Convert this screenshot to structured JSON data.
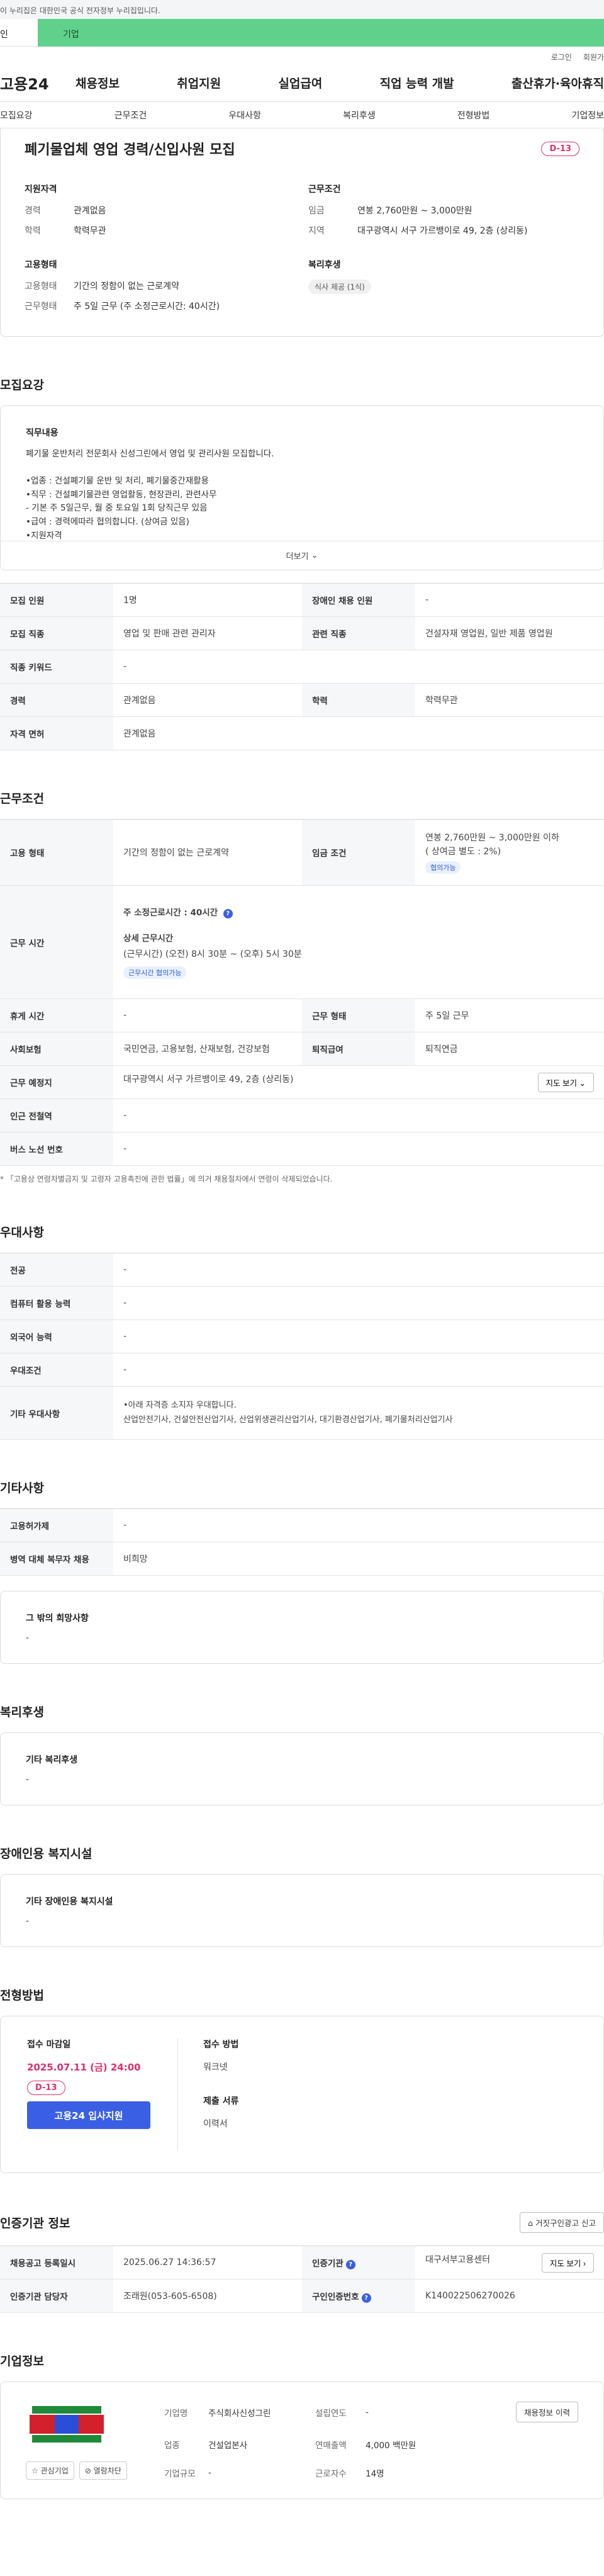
{
  "gov_bar": "이 누리집은 대한민국 공식 전자정부 누리집입니다.",
  "tabs": {
    "first": "인",
    "second": "기업"
  },
  "utility": {
    "login": "로그인",
    "join": "회원가"
  },
  "gnb": {
    "logo": "고용24",
    "menu": [
      "채용정보",
      "취업지원",
      "실업급여",
      "직업 능력 개발",
      "출산휴가·육아휴직"
    ]
  },
  "subnav": [
    "모집요강",
    "근무조건",
    "우대사항",
    "복리후생",
    "전형방법",
    "기업정보"
  ],
  "summary": {
    "title": "폐기물업체 영업 경력/신입사원 모집",
    "dday": "D-13",
    "qualification": {
      "heading": "지원자격",
      "career_label": "경력",
      "career": "관계없음",
      "edu_label": "학력",
      "edu": "학력무관"
    },
    "conditions": {
      "heading": "근무조건",
      "pay_label": "임금",
      "pay": "연봉 2,760만원 ~ 3,000만원",
      "region_label": "지역",
      "region": "대구광역시 서구 가르뱅이로 49, 2층 (상리동)"
    },
    "employment": {
      "heading": "고용형태",
      "type_label": "고용형태",
      "type": "기간의 정함이 없는 근로계약",
      "work_label": "근무형태",
      "work": "주 5일 근무 (주 소정근로시간: 40시간)"
    },
    "welfare": {
      "heading": "복리후생",
      "badge": "식사 제공 (1식)"
    }
  },
  "recruit": {
    "section": "모집요강",
    "duty_heading": "직무내용",
    "duty_text": "폐기물 운반처리 전문회사 신성그린에서 영업 및 관리사원 모집합니다.\n\n•업종 : 건설폐기물 운반 및 처리, 폐기물중간재활용\n•직무 : 건설폐기물관련 영업활동, 현장관리, 관련사무\n   - 기본 주 5일근무, 월 중 토요일 1회 당직근무 있음\n•급여 : 경력에따라 협의합니다. (상여금 있음)\n•지원자격\n   - 운전면허소지자\n   - 활발하고 책임감 있는 분",
    "more": "더보기",
    "rows": [
      [
        "모집 인원",
        "1명",
        "장애인 채용 인원",
        "-"
      ],
      [
        "모집 직종",
        "영업 및 판매 관련 관리자",
        "관련 직종",
        "건설자재 영업원, 일반 제품 영업원"
      ],
      [
        "직종 키워드",
        "-"
      ],
      [
        "경력",
        "관계없음",
        "학력",
        "학력무관"
      ],
      [
        "자격 면허",
        "관계없음"
      ]
    ]
  },
  "work": {
    "section": "근무조건",
    "type_label": "고용 형태",
    "type": "기간의 정함이 없는 근로계약",
    "pay_label": "임금 조건",
    "pay1": "연봉 2,760만원 ~ 3,000만원 이하",
    "pay2": "( 상여금 별도 : 2%)",
    "pay_tag": "협의가능",
    "hours_label": "근무 시간",
    "weekly": "주 소정근로시간 : 40시간",
    "detail_heading": "상세 근무시간",
    "detail": "(근무시간) (오전) 8시 30분 ~ (오후) 5시 30분",
    "hours_tag": "근무시간 협의가능",
    "rows": [
      [
        "휴게 시간",
        "-",
        "근무 형태",
        "주 5일 근무"
      ],
      [
        "사회보험",
        "국민연금, 고용보험, 산재보험, 건강보험",
        "퇴직급여",
        "퇴직연금"
      ]
    ],
    "place_label": "근무 예정지",
    "place": "대구광역시 서구 가르뱅이로 49, 2층 (상리동)",
    "map": "지도 보기",
    "station_label": "인근 전철역",
    "station": "-",
    "bus_label": "버스 노선 번호",
    "bus": "-",
    "note": "* 「고용상 연령차별금지 및 고령자 고용촉진에 관한 법률」에 의거 채용절차에서 연령이 삭제되었습니다."
  },
  "pref": {
    "section": "우대사항",
    "rows": [
      [
        "전공",
        "-"
      ],
      [
        "컴퓨터 활용 능력",
        "-"
      ],
      [
        "외국어 능력",
        "-"
      ],
      [
        "우대조건",
        "-"
      ]
    ],
    "etc_label": "기타 우대사항",
    "etc1": "•아래 자격증 소지자 우대합니다.",
    "etc2": "산업안전기사, 건설안전산업기사, 산업위생관리산업기사, 대기환경산업기사, 폐기물처리산업기사"
  },
  "other": {
    "section": "기타사항",
    "rows": [
      [
        "고용허가제",
        "-"
      ],
      [
        "병역 대체 복무자 채용",
        "비희망"
      ]
    ],
    "etc_heading": "그 밖의 희망사항",
    "etc": "-"
  },
  "welfare": {
    "section": "복리후생",
    "heading": "기타 복리후생",
    "val": "-"
  },
  "disabled": {
    "section": "장애인용 복지시설",
    "heading": "기타 장애인용 복지시설",
    "val": "-"
  },
  "apply": {
    "section": "전형방법",
    "deadline_heading": "접수 마감일",
    "deadline": "2025.07.11 (금) 24:00",
    "dday": "D-13",
    "button": "고용24 입사지원",
    "method_heading": "접수 방법",
    "method": "워크넷",
    "docs_heading": "제출 서류",
    "docs": "이력서"
  },
  "org": {
    "section": "인증기관 정보",
    "report": "거짓구인광고 신고",
    "reg_label": "채용공고 등록일시",
    "reg": "2025.06.27 14:36:57",
    "agency_label": "인증기관",
    "agency": "대구서부고용센터",
    "map": "지도 보기",
    "manager_label": "인증기관 담당자",
    "manager": "조래원(053-605-6508)",
    "cert_label": "구인인증번호",
    "cert": "K140022506270026"
  },
  "company": {
    "section": "기업정보",
    "history": "채용정보 이력",
    "interest": "관심기업",
    "block": "열람차단",
    "name_label": "기업명",
    "name": "주식회사신성그린",
    "founded_label": "설립연도",
    "founded": "-",
    "industry_label": "업종",
    "industry": "건설업본사",
    "sales_label": "연매출액",
    "sales": "4,000 백만원",
    "size_label": "기업규모",
    "size": "-",
    "emp_label": "근로자수",
    "emp": "14명"
  }
}
